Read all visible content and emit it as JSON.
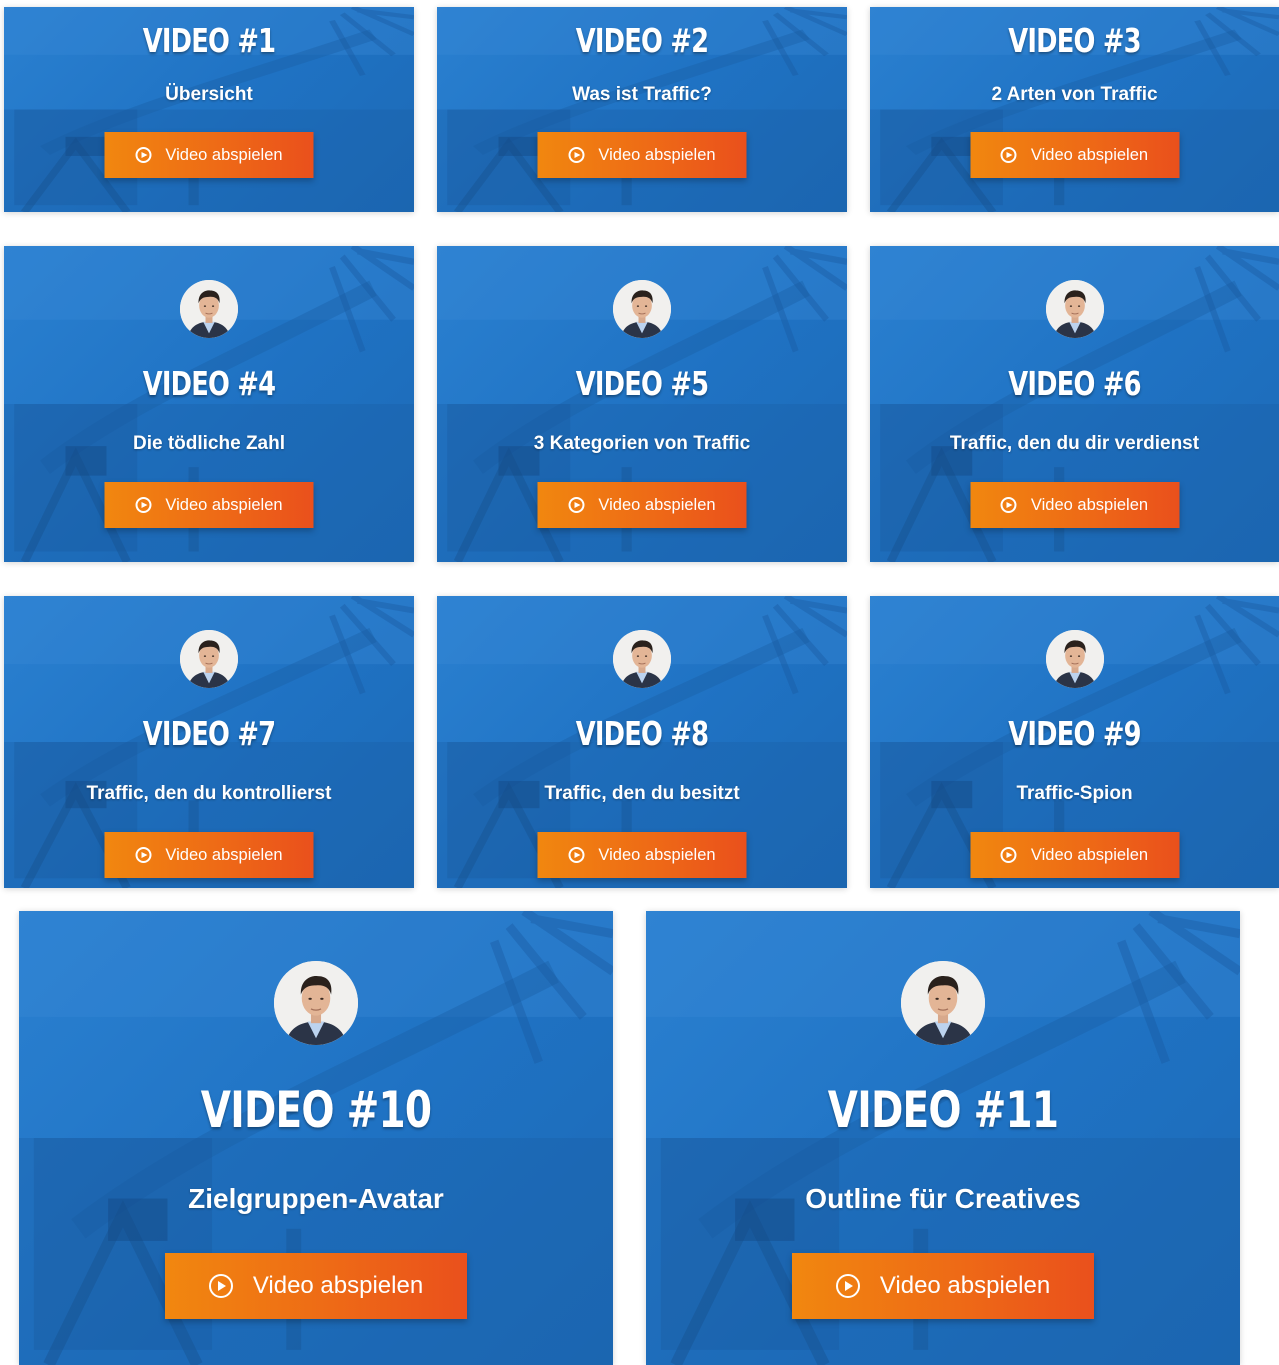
{
  "button_label": "Video abspielen",
  "colors": {
    "card_blue": "#1f72c3",
    "button_orange_start": "#f1870f",
    "button_orange_end": "#ea501c"
  },
  "icons": {
    "button": "play-circle-icon",
    "avatar": "presenter-avatar"
  },
  "videos": [
    {
      "title": "VIDEO #1",
      "subtitle": "Übersicht"
    },
    {
      "title": "VIDEO #2",
      "subtitle": "Was ist Traffic?"
    },
    {
      "title": "VIDEO #3",
      "subtitle": "2 Arten von Traffic"
    },
    {
      "title": "VIDEO #4",
      "subtitle": "Die tödliche Zahl"
    },
    {
      "title": "VIDEO #5",
      "subtitle": "3 Kategorien von Traffic"
    },
    {
      "title": "VIDEO #6",
      "subtitle": "Traffic, den du dir verdienst"
    },
    {
      "title": "VIDEO #7",
      "subtitle": "Traffic, den du kontrollierst"
    },
    {
      "title": "VIDEO #8",
      "subtitle": "Traffic, den du besitzt"
    },
    {
      "title": "VIDEO #9",
      "subtitle": "Traffic-Spion"
    },
    {
      "title": "VIDEO #10",
      "subtitle": "Zielgruppen-Avatar"
    },
    {
      "title": "VIDEO #11",
      "subtitle": "Outline für Creatives"
    }
  ]
}
